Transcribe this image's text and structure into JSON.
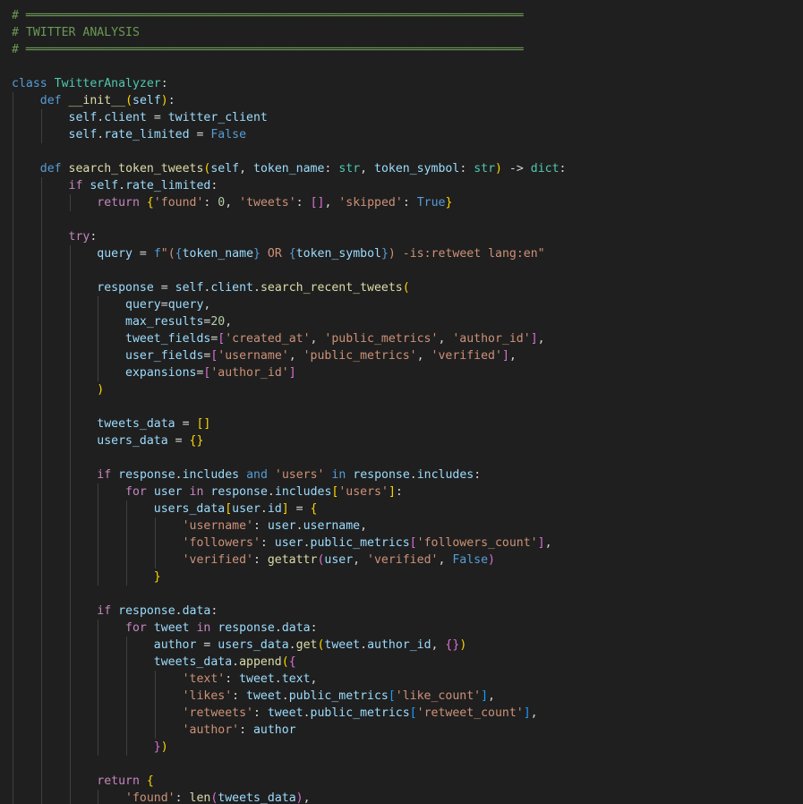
{
  "editor": {
    "language": "python",
    "colors": {
      "background": "#1f1f1f",
      "comment": "#6a9955",
      "keyword": "#569cd6",
      "control": "#c586c0",
      "class": "#4ec9b0",
      "function": "#dcdcaa",
      "variable": "#9cdcfe",
      "string": "#ce9178",
      "number": "#b5cea8",
      "bracket_1": "#ffd700",
      "bracket_2": "#da70d6",
      "bracket_3": "#179fff"
    },
    "lines": [
      {
        "indent": 0,
        "tokens": [
          [
            "cmt",
            "# ══════════════════════════════════════════════════════════════════════"
          ]
        ]
      },
      {
        "indent": 0,
        "tokens": [
          [
            "cmt",
            "# TWITTER ANALYSIS"
          ]
        ]
      },
      {
        "indent": 0,
        "tokens": [
          [
            "cmt",
            "# ══════════════════════════════════════════════════════════════════════"
          ]
        ]
      },
      {
        "indent": 0,
        "tokens": []
      },
      {
        "indent": 0,
        "tokens": [
          [
            "kw",
            "class"
          ],
          [
            "pl",
            " "
          ],
          [
            "cls",
            "TwitterAnalyzer"
          ],
          [
            "op",
            ":"
          ]
        ]
      },
      {
        "indent": 1,
        "tokens": [
          [
            "kw",
            "def"
          ],
          [
            "pl",
            " "
          ],
          [
            "fn",
            "__init__"
          ],
          [
            "b1",
            "("
          ],
          [
            "var",
            "self"
          ],
          [
            "b1",
            ")"
          ],
          [
            "op",
            ":"
          ]
        ]
      },
      {
        "indent": 2,
        "tokens": [
          [
            "var",
            "self"
          ],
          [
            "op",
            "."
          ],
          [
            "var",
            "client"
          ],
          [
            "op",
            " = "
          ],
          [
            "var",
            "twitter_client"
          ]
        ]
      },
      {
        "indent": 2,
        "tokens": [
          [
            "var",
            "self"
          ],
          [
            "op",
            "."
          ],
          [
            "var",
            "rate_limited"
          ],
          [
            "op",
            " = "
          ],
          [
            "kw",
            "False"
          ]
        ]
      },
      {
        "indent": 1,
        "tokens": []
      },
      {
        "indent": 1,
        "tokens": [
          [
            "kw",
            "def"
          ],
          [
            "pl",
            " "
          ],
          [
            "fn",
            "search_token_tweets"
          ],
          [
            "b1",
            "("
          ],
          [
            "var",
            "self"
          ],
          [
            "op",
            ", "
          ],
          [
            "var",
            "token_name"
          ],
          [
            "op",
            ": "
          ],
          [
            "cls",
            "str"
          ],
          [
            "op",
            ", "
          ],
          [
            "var",
            "token_symbol"
          ],
          [
            "op",
            ": "
          ],
          [
            "cls",
            "str"
          ],
          [
            "b1",
            ")"
          ],
          [
            "op",
            " -> "
          ],
          [
            "cls",
            "dict"
          ],
          [
            "op",
            ":"
          ]
        ]
      },
      {
        "indent": 2,
        "tokens": [
          [
            "ctl",
            "if"
          ],
          [
            "pl",
            " "
          ],
          [
            "var",
            "self"
          ],
          [
            "op",
            "."
          ],
          [
            "var",
            "rate_limited"
          ],
          [
            "op",
            ":"
          ]
        ]
      },
      {
        "indent": 3,
        "tokens": [
          [
            "ctl",
            "return"
          ],
          [
            "pl",
            " "
          ],
          [
            "b1",
            "{"
          ],
          [
            "str",
            "'found'"
          ],
          [
            "op",
            ": "
          ],
          [
            "num",
            "0"
          ],
          [
            "op",
            ", "
          ],
          [
            "str",
            "'tweets'"
          ],
          [
            "op",
            ": "
          ],
          [
            "b2",
            "[]"
          ],
          [
            "op",
            ", "
          ],
          [
            "str",
            "'skipped'"
          ],
          [
            "op",
            ": "
          ],
          [
            "kw",
            "True"
          ],
          [
            "b1",
            "}"
          ]
        ]
      },
      {
        "indent": 2,
        "tokens": []
      },
      {
        "indent": 2,
        "tokens": [
          [
            "ctl",
            "try"
          ],
          [
            "op",
            ":"
          ]
        ]
      },
      {
        "indent": 3,
        "tokens": [
          [
            "var",
            "query"
          ],
          [
            "op",
            " = "
          ],
          [
            "kw",
            "f"
          ],
          [
            "str",
            "\"("
          ],
          [
            "kw",
            "{"
          ],
          [
            "var",
            "token_name"
          ],
          [
            "kw",
            "}"
          ],
          [
            "str",
            " OR "
          ],
          [
            "kw",
            "{"
          ],
          [
            "var",
            "token_symbol"
          ],
          [
            "kw",
            "}"
          ],
          [
            "str",
            ") -is:retweet lang:en\""
          ]
        ]
      },
      {
        "indent": 3,
        "tokens": []
      },
      {
        "indent": 3,
        "tokens": [
          [
            "var",
            "response"
          ],
          [
            "op",
            " = "
          ],
          [
            "var",
            "self"
          ],
          [
            "op",
            "."
          ],
          [
            "var",
            "client"
          ],
          [
            "op",
            "."
          ],
          [
            "fn",
            "search_recent_tweets"
          ],
          [
            "b1",
            "("
          ]
        ]
      },
      {
        "indent": 4,
        "tokens": [
          [
            "var",
            "query"
          ],
          [
            "op",
            "="
          ],
          [
            "var",
            "query"
          ],
          [
            "op",
            ","
          ]
        ]
      },
      {
        "indent": 4,
        "tokens": [
          [
            "var",
            "max_results"
          ],
          [
            "op",
            "="
          ],
          [
            "num",
            "20"
          ],
          [
            "op",
            ","
          ]
        ]
      },
      {
        "indent": 4,
        "tokens": [
          [
            "var",
            "tweet_fields"
          ],
          [
            "op",
            "="
          ],
          [
            "b2",
            "["
          ],
          [
            "str",
            "'created_at'"
          ],
          [
            "op",
            ", "
          ],
          [
            "str",
            "'public_metrics'"
          ],
          [
            "op",
            ", "
          ],
          [
            "str",
            "'author_id'"
          ],
          [
            "b2",
            "]"
          ],
          [
            "op",
            ","
          ]
        ]
      },
      {
        "indent": 4,
        "tokens": [
          [
            "var",
            "user_fields"
          ],
          [
            "op",
            "="
          ],
          [
            "b2",
            "["
          ],
          [
            "str",
            "'username'"
          ],
          [
            "op",
            ", "
          ],
          [
            "str",
            "'public_metrics'"
          ],
          [
            "op",
            ", "
          ],
          [
            "str",
            "'verified'"
          ],
          [
            "b2",
            "]"
          ],
          [
            "op",
            ","
          ]
        ]
      },
      {
        "indent": 4,
        "tokens": [
          [
            "var",
            "expansions"
          ],
          [
            "op",
            "="
          ],
          [
            "b2",
            "["
          ],
          [
            "str",
            "'author_id'"
          ],
          [
            "b2",
            "]"
          ]
        ]
      },
      {
        "indent": 3,
        "tokens": [
          [
            "b1",
            ")"
          ]
        ]
      },
      {
        "indent": 3,
        "tokens": []
      },
      {
        "indent": 3,
        "tokens": [
          [
            "var",
            "tweets_data"
          ],
          [
            "op",
            " = "
          ],
          [
            "b1",
            "[]"
          ]
        ]
      },
      {
        "indent": 3,
        "tokens": [
          [
            "var",
            "users_data"
          ],
          [
            "op",
            " = "
          ],
          [
            "b1",
            "{}"
          ]
        ]
      },
      {
        "indent": 3,
        "tokens": []
      },
      {
        "indent": 3,
        "tokens": [
          [
            "ctl",
            "if"
          ],
          [
            "pl",
            " "
          ],
          [
            "var",
            "response"
          ],
          [
            "op",
            "."
          ],
          [
            "var",
            "includes"
          ],
          [
            "pl",
            " "
          ],
          [
            "kw",
            "and"
          ],
          [
            "pl",
            " "
          ],
          [
            "str",
            "'users'"
          ],
          [
            "pl",
            " "
          ],
          [
            "kw",
            "in"
          ],
          [
            "pl",
            " "
          ],
          [
            "var",
            "response"
          ],
          [
            "op",
            "."
          ],
          [
            "var",
            "includes"
          ],
          [
            "op",
            ":"
          ]
        ]
      },
      {
        "indent": 4,
        "tokens": [
          [
            "ctl",
            "for"
          ],
          [
            "pl",
            " "
          ],
          [
            "var",
            "user"
          ],
          [
            "pl",
            " "
          ],
          [
            "ctl",
            "in"
          ],
          [
            "pl",
            " "
          ],
          [
            "var",
            "response"
          ],
          [
            "op",
            "."
          ],
          [
            "var",
            "includes"
          ],
          [
            "b1",
            "["
          ],
          [
            "str",
            "'users'"
          ],
          [
            "b1",
            "]"
          ],
          [
            "op",
            ":"
          ]
        ]
      },
      {
        "indent": 5,
        "tokens": [
          [
            "var",
            "users_data"
          ],
          [
            "b1",
            "["
          ],
          [
            "var",
            "user"
          ],
          [
            "op",
            "."
          ],
          [
            "var",
            "id"
          ],
          [
            "b1",
            "]"
          ],
          [
            "op",
            " = "
          ],
          [
            "b1",
            "{"
          ]
        ]
      },
      {
        "indent": 6,
        "tokens": [
          [
            "str",
            "'username'"
          ],
          [
            "op",
            ": "
          ],
          [
            "var",
            "user"
          ],
          [
            "op",
            "."
          ],
          [
            "var",
            "username"
          ],
          [
            "op",
            ","
          ]
        ]
      },
      {
        "indent": 6,
        "tokens": [
          [
            "str",
            "'followers'"
          ],
          [
            "op",
            ": "
          ],
          [
            "var",
            "user"
          ],
          [
            "op",
            "."
          ],
          [
            "var",
            "public_metrics"
          ],
          [
            "b2",
            "["
          ],
          [
            "str",
            "'followers_count'"
          ],
          [
            "b2",
            "]"
          ],
          [
            "op",
            ","
          ]
        ]
      },
      {
        "indent": 6,
        "tokens": [
          [
            "str",
            "'verified'"
          ],
          [
            "op",
            ": "
          ],
          [
            "fn",
            "getattr"
          ],
          [
            "b2",
            "("
          ],
          [
            "var",
            "user"
          ],
          [
            "op",
            ", "
          ],
          [
            "str",
            "'verified'"
          ],
          [
            "op",
            ", "
          ],
          [
            "kw",
            "False"
          ],
          [
            "b2",
            ")"
          ]
        ]
      },
      {
        "indent": 5,
        "tokens": [
          [
            "b1",
            "}"
          ]
        ]
      },
      {
        "indent": 3,
        "tokens": []
      },
      {
        "indent": 3,
        "tokens": [
          [
            "ctl",
            "if"
          ],
          [
            "pl",
            " "
          ],
          [
            "var",
            "response"
          ],
          [
            "op",
            "."
          ],
          [
            "var",
            "data"
          ],
          [
            "op",
            ":"
          ]
        ]
      },
      {
        "indent": 4,
        "tokens": [
          [
            "ctl",
            "for"
          ],
          [
            "pl",
            " "
          ],
          [
            "var",
            "tweet"
          ],
          [
            "pl",
            " "
          ],
          [
            "ctl",
            "in"
          ],
          [
            "pl",
            " "
          ],
          [
            "var",
            "response"
          ],
          [
            "op",
            "."
          ],
          [
            "var",
            "data"
          ],
          [
            "op",
            ":"
          ]
        ]
      },
      {
        "indent": 5,
        "tokens": [
          [
            "var",
            "author"
          ],
          [
            "op",
            " = "
          ],
          [
            "var",
            "users_data"
          ],
          [
            "op",
            "."
          ],
          [
            "fn",
            "get"
          ],
          [
            "b1",
            "("
          ],
          [
            "var",
            "tweet"
          ],
          [
            "op",
            "."
          ],
          [
            "var",
            "author_id"
          ],
          [
            "op",
            ", "
          ],
          [
            "b2",
            "{}"
          ],
          [
            "b1",
            ")"
          ]
        ]
      },
      {
        "indent": 5,
        "tokens": [
          [
            "var",
            "tweets_data"
          ],
          [
            "op",
            "."
          ],
          [
            "fn",
            "append"
          ],
          [
            "b1",
            "("
          ],
          [
            "b2",
            "{"
          ]
        ]
      },
      {
        "indent": 6,
        "tokens": [
          [
            "str",
            "'text'"
          ],
          [
            "op",
            ": "
          ],
          [
            "var",
            "tweet"
          ],
          [
            "op",
            "."
          ],
          [
            "var",
            "text"
          ],
          [
            "op",
            ","
          ]
        ]
      },
      {
        "indent": 6,
        "tokens": [
          [
            "str",
            "'likes'"
          ],
          [
            "op",
            ": "
          ],
          [
            "var",
            "tweet"
          ],
          [
            "op",
            "."
          ],
          [
            "var",
            "public_metrics"
          ],
          [
            "b3",
            "["
          ],
          [
            "str",
            "'like_count'"
          ],
          [
            "b3",
            "]"
          ],
          [
            "op",
            ","
          ]
        ]
      },
      {
        "indent": 6,
        "tokens": [
          [
            "str",
            "'retweets'"
          ],
          [
            "op",
            ": "
          ],
          [
            "var",
            "tweet"
          ],
          [
            "op",
            "."
          ],
          [
            "var",
            "public_metrics"
          ],
          [
            "b3",
            "["
          ],
          [
            "str",
            "'retweet_count'"
          ],
          [
            "b3",
            "]"
          ],
          [
            "op",
            ","
          ]
        ]
      },
      {
        "indent": 6,
        "tokens": [
          [
            "str",
            "'author'"
          ],
          [
            "op",
            ": "
          ],
          [
            "var",
            "author"
          ]
        ]
      },
      {
        "indent": 5,
        "tokens": [
          [
            "b2",
            "}"
          ],
          [
            "b1",
            ")"
          ]
        ]
      },
      {
        "indent": 3,
        "tokens": []
      },
      {
        "indent": 3,
        "tokens": [
          [
            "ctl",
            "return"
          ],
          [
            "pl",
            " "
          ],
          [
            "b1",
            "{"
          ]
        ]
      },
      {
        "indent": 4,
        "tokens": [
          [
            "str",
            "'found'"
          ],
          [
            "op",
            ": "
          ],
          [
            "fn",
            "len"
          ],
          [
            "b2",
            "("
          ],
          [
            "var",
            "tweets_data"
          ],
          [
            "b2",
            ")"
          ],
          [
            "op",
            ","
          ]
        ]
      }
    ]
  }
}
